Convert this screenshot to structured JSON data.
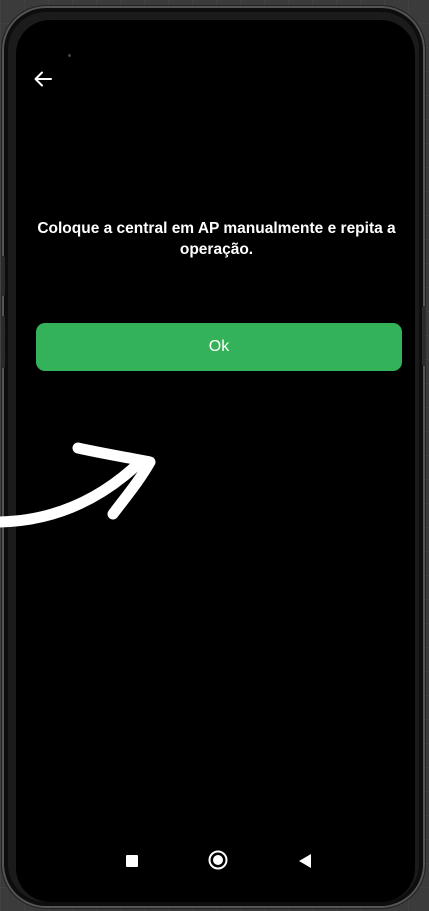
{
  "dialog": {
    "message": "Coloque a central em AP manualmente e repita a operação.",
    "ok_label": "Ok"
  },
  "icons": {
    "back": "arrow-left-icon",
    "annotation": "curved-arrow-annotation",
    "nav_recents": "square-icon",
    "nav_home": "circle-icon",
    "nav_back": "triangle-left-icon"
  },
  "colors": {
    "accent": "#34b25a",
    "screen_background": "#000000",
    "text": "#ffffff"
  }
}
